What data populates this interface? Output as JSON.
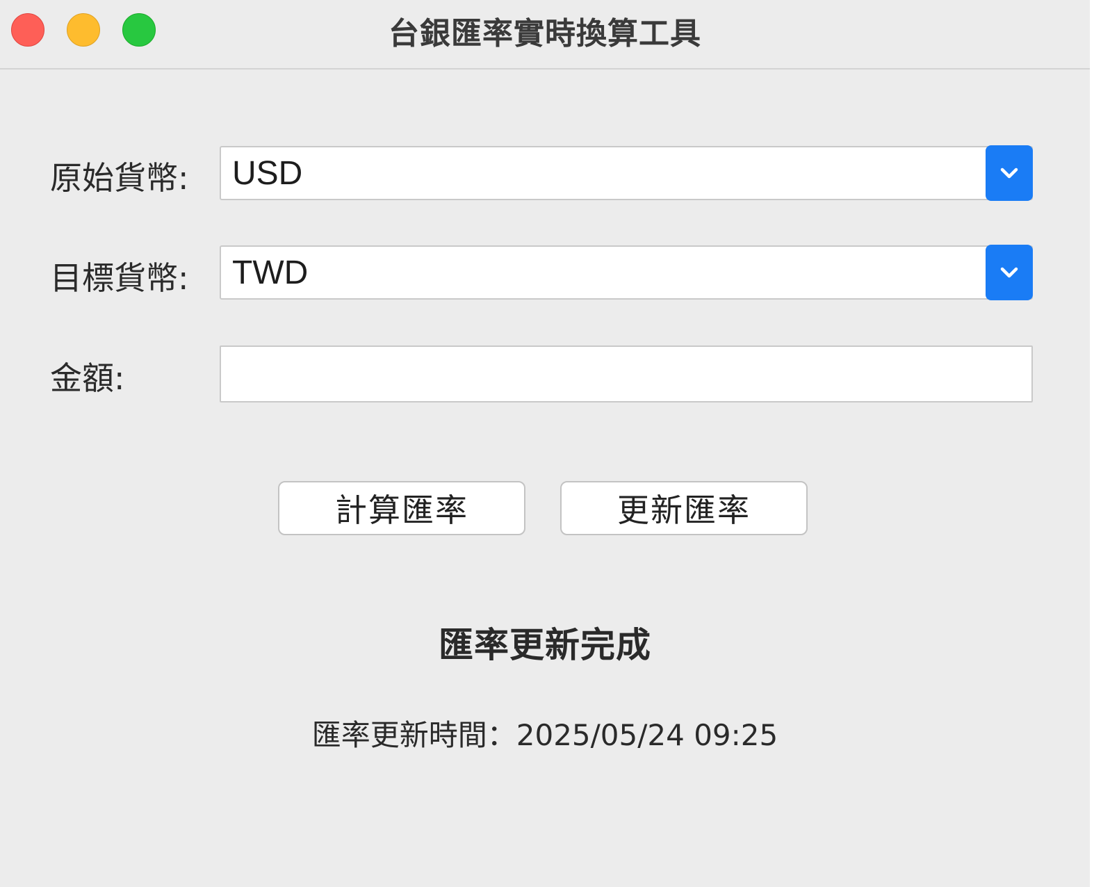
{
  "window": {
    "title": "台銀匯率實時換算工具"
  },
  "form": {
    "source_label": "原始貨幣:",
    "source_value": "USD",
    "target_label": "目標貨幣:",
    "target_value": "TWD",
    "amount_label": "金額:",
    "amount_value": ""
  },
  "buttons": {
    "calculate_label": "計算匯率",
    "update_label": "更新匯率"
  },
  "status": {
    "message": "匯率更新完成",
    "update_time": "匯率更新時間：2025/05/24 09:25"
  },
  "colors": {
    "accent": "#1a7cf5",
    "close": "#fe5f57",
    "minimize": "#febc2e",
    "maximize": "#28c840"
  },
  "icons": {
    "dropdown": "chevron-down-icon"
  }
}
